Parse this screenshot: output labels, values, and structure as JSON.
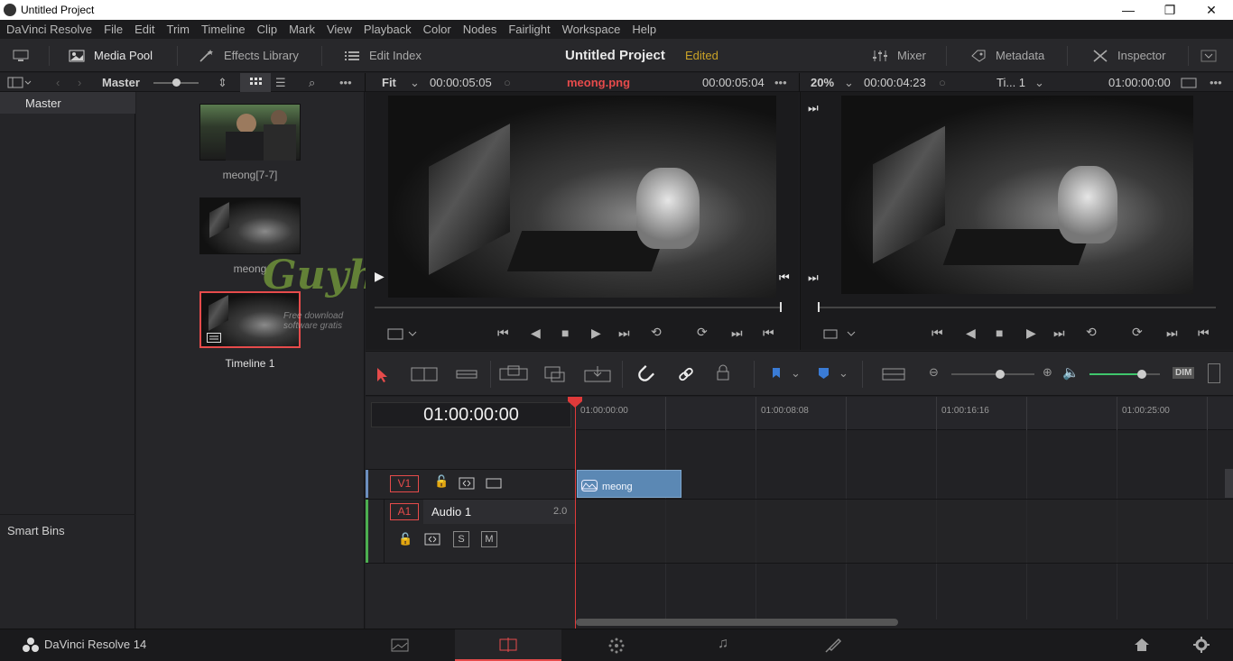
{
  "window": {
    "title": "Untitled Project",
    "min": "—",
    "max": "❐",
    "close": "✕"
  },
  "menu": [
    "DaVinci Resolve",
    "File",
    "Edit",
    "Trim",
    "Timeline",
    "Clip",
    "Mark",
    "View",
    "Playback",
    "Color",
    "Nodes",
    "Fairlight",
    "Workspace",
    "Help"
  ],
  "toolbar": {
    "media_pool": "Media Pool",
    "effects_library": "Effects Library",
    "edit_index": "Edit Index",
    "project_name": "Untitled Project",
    "edited": "Edited",
    "mixer": "Mixer",
    "metadata": "Metadata",
    "inspector": "Inspector"
  },
  "bar2": {
    "bin": "Master",
    "fit": "Fit",
    "src_timecode": "00:00:05:05",
    "clip_name": "meong.png",
    "clip_duration": "00:00:05:04",
    "zoom": "20%",
    "rec_timecode": "00:00:04:23",
    "timeline_name": "Ti... 1",
    "rec_position": "01:00:00:00"
  },
  "bins": {
    "master": "Master",
    "smart_bins": "Smart Bins"
  },
  "media_items": [
    {
      "label": "meong[7-7]"
    },
    {
      "label": "meong"
    },
    {
      "label": "Timeline 1"
    }
  ],
  "watermark": {
    "brand": "GuyhAaMe",
    "tagline": "Free download software gratis"
  },
  "timeline": {
    "timecode": "01:00:00:00",
    "ruler": [
      "01:00:00:00",
      "01:00:08:08",
      "01:00:16:16",
      "01:00:25:00"
    ],
    "v1": "V1",
    "a1": "A1",
    "audio_name": "Audio 1",
    "audio_channels": "2.0",
    "solo": "S",
    "mute": "M",
    "clip": "meong"
  },
  "edit_tools": {
    "dim": "DIM"
  },
  "footer": {
    "app": "DaVinci Resolve 14"
  },
  "colors": {
    "accent_red": "#e64b4b",
    "edited_yellow": "#c9a227",
    "clip_blue": "#5b88b4",
    "playhead": "#e03a3a"
  }
}
